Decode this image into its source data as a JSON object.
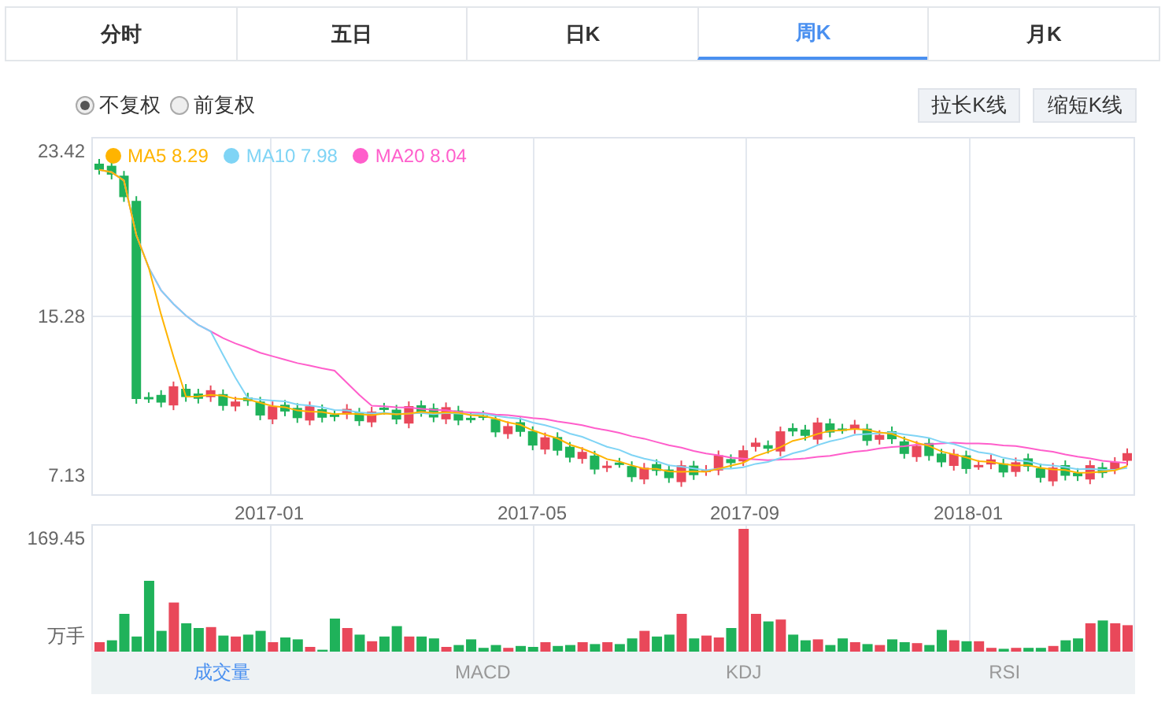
{
  "period_tabs": [
    {
      "label": "分时",
      "selected": false
    },
    {
      "label": "五日",
      "selected": false
    },
    {
      "label": "日K",
      "selected": false
    },
    {
      "label": "周K",
      "selected": true
    },
    {
      "label": "月K",
      "selected": false
    }
  ],
  "adjust_options": [
    {
      "label": "不复权",
      "selected": true
    },
    {
      "label": "前复权",
      "selected": false
    }
  ],
  "buttons": [
    "拉长K线",
    "缩短K线"
  ],
  "legend": [
    {
      "label": "MA5 8.29",
      "color": "#ffb400"
    },
    {
      "label": "MA10 7.98",
      "color": "#7fd4f5"
    },
    {
      "label": "MA20 8.04",
      "color": "#ff5ecb"
    }
  ],
  "price_axis": [
    "23.42",
    "15.28",
    "7.13"
  ],
  "date_axis": [
    "2017-01",
    "2017-05",
    "2017-09",
    "2018-01"
  ],
  "volume_axis": {
    "max": "169.45",
    "unit": "万手"
  },
  "indicator_tabs": [
    {
      "label": "成交量",
      "selected": true
    },
    {
      "label": "MACD",
      "selected": false
    },
    {
      "label": "KDJ",
      "selected": false
    },
    {
      "label": "RSI",
      "selected": false
    }
  ]
}
